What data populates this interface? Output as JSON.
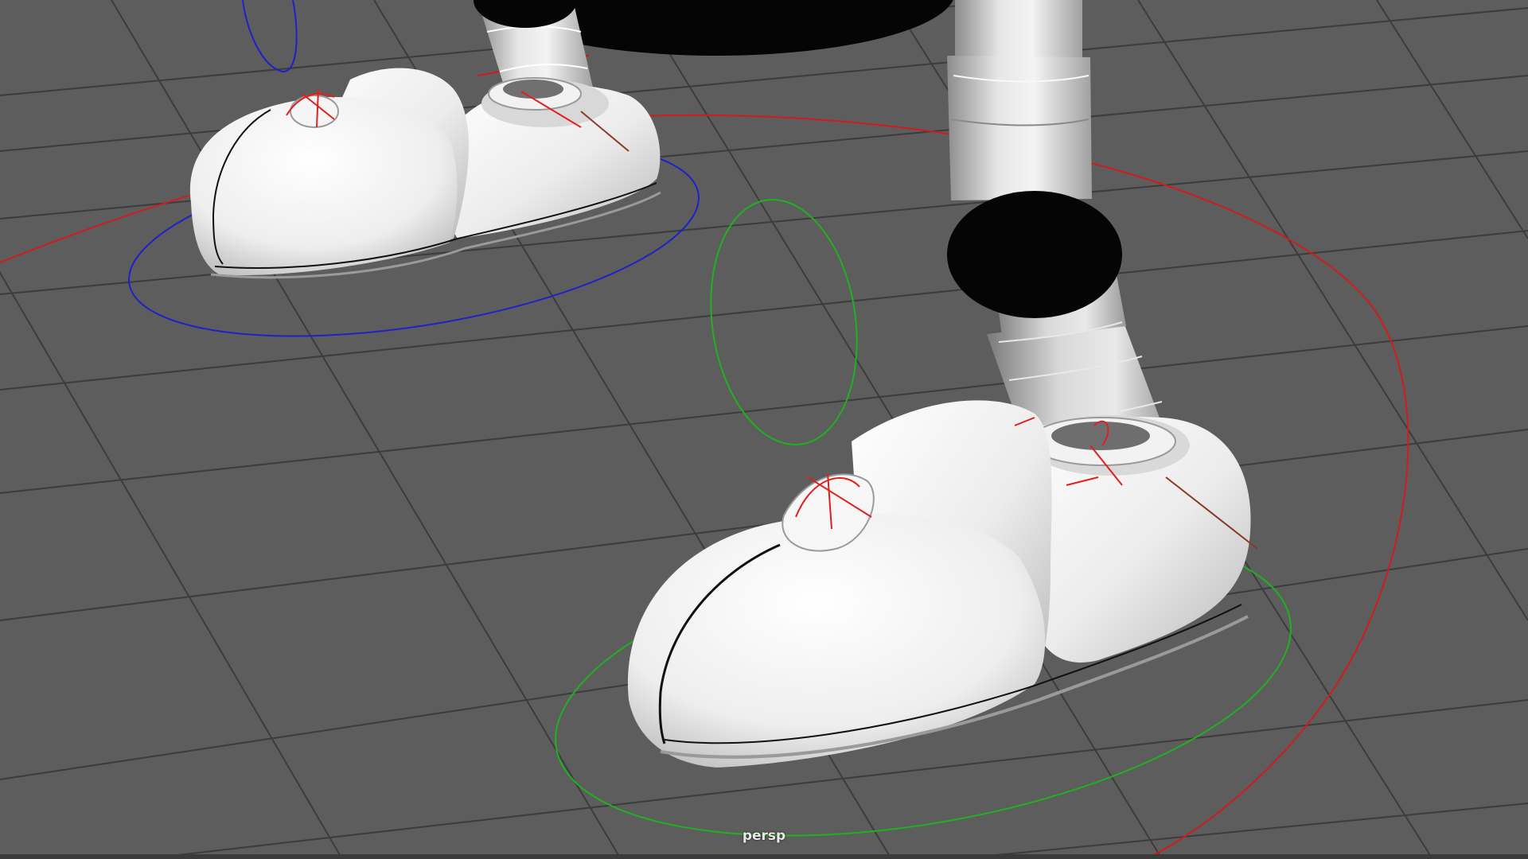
{
  "viewport": {
    "camera_name": "persp",
    "background_color": "#5d5d5d",
    "grid_color": "#3a3a3a"
  },
  "scene_objects": [
    {
      "name": "left-shoe",
      "type": "mesh"
    },
    {
      "name": "right-shoe",
      "type": "mesh"
    },
    {
      "name": "left-leg",
      "type": "mesh"
    },
    {
      "name": "right-leg",
      "type": "mesh"
    },
    {
      "name": "knee-joint",
      "type": "mesh"
    },
    {
      "name": "body",
      "type": "mesh"
    }
  ],
  "controls": [
    {
      "name": "left-foot-control",
      "color": "#2020c8"
    },
    {
      "name": "right-foot-control",
      "color": "#20b020"
    },
    {
      "name": "root-control",
      "color": "#d01c1c"
    },
    {
      "name": "knee-control",
      "color": "#20b020"
    },
    {
      "name": "left-knee-control",
      "color": "#2020c8"
    }
  ],
  "colors": {
    "mesh_light": "#f6f6f6",
    "mesh_shadow": "#bdbdbd",
    "black_mesh": "#050505",
    "joint_red": "#e02020"
  }
}
